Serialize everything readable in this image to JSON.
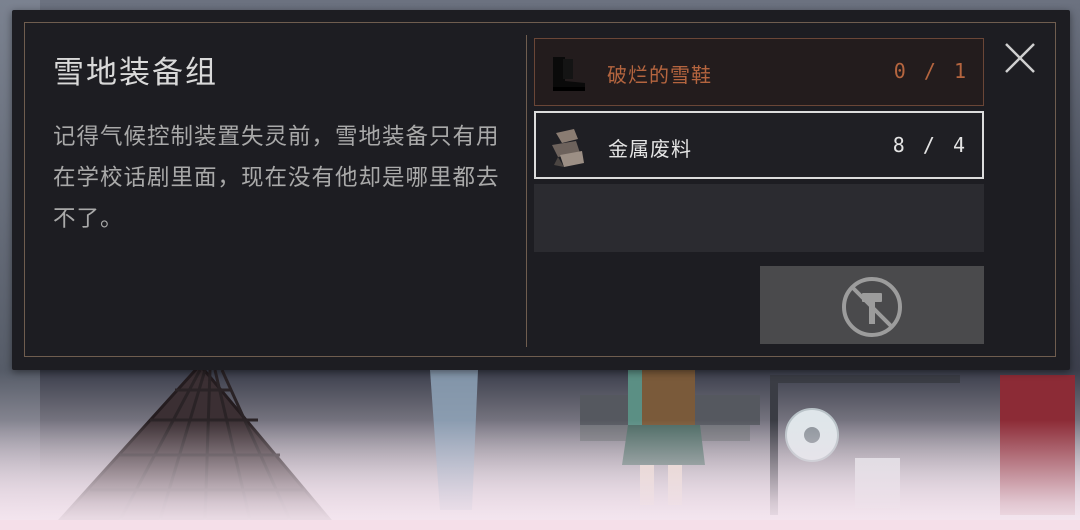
{
  "recipe": {
    "title": "雪地装备组",
    "description": "记得气候控制装置失灵前，雪地装备只有用在学校话剧里面，现在没有他却是哪里都去不了。"
  },
  "requirements": [
    {
      "name": "破烂的雪鞋",
      "count": "0 / 1",
      "icon": "snow-boots-icon",
      "status_color": "#b5653f"
    },
    {
      "name": "金属废料",
      "count": "8 / 4",
      "icon": "scrap-metal-icon",
      "status_color": "#e4e4e4"
    }
  ],
  "actions": {
    "craft_icon": "hammer-disabled-icon",
    "close_icon": "close-icon"
  }
}
